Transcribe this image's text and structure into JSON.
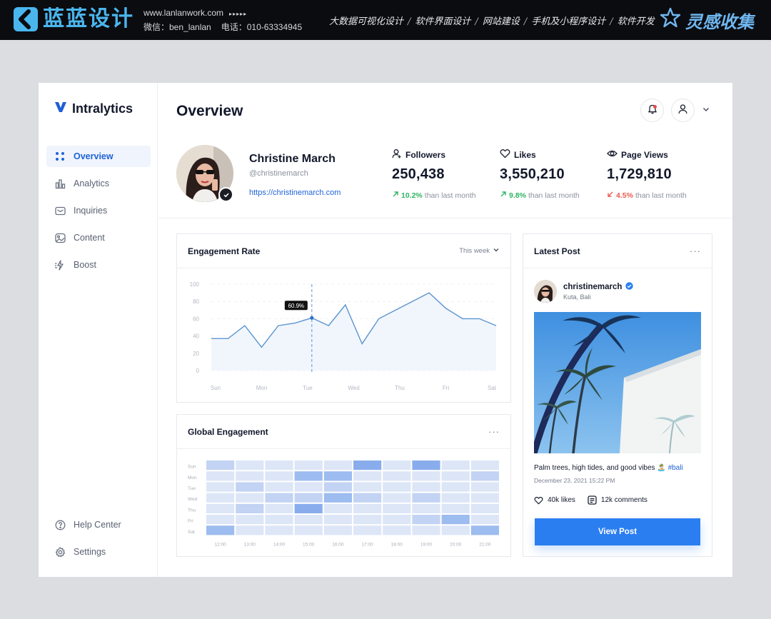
{
  "banner": {
    "brand": "蓝蓝设计",
    "website": "www.lanlanwork.com",
    "arrows": "▸▸▸▸▸",
    "wechat": "微信：ben_lanlan",
    "phone": "电话：010-63334945",
    "services": [
      "大数据可视化设计",
      "软件界面设计",
      "网站建设",
      "手机及小程序设计",
      "软件开发"
    ],
    "separator": "/",
    "collect": "灵感收集"
  },
  "app": {
    "logo": "Intralytics",
    "nav": [
      {
        "label": "Overview",
        "icon": "grid-dots-icon",
        "active": true
      },
      {
        "label": "Analytics",
        "icon": "bar-chart-icon"
      },
      {
        "label": "Inquiries",
        "icon": "mail-icon"
      },
      {
        "label": "Content",
        "icon": "image-icon"
      },
      {
        "label": "Boost",
        "icon": "boost-icon"
      }
    ],
    "nav_bottom": [
      {
        "label": "Help Center",
        "icon": "help-icon"
      },
      {
        "label": "Settings",
        "icon": "gear-icon"
      }
    ],
    "page_title": "Overview",
    "profile": {
      "name": "Christine March",
      "handle": "@christinemarch",
      "link": "https://christinemarch.com"
    },
    "stats": [
      {
        "label": "Followers",
        "icon": "user-icon",
        "value": "250,438",
        "change": "10.2%",
        "direction": "up",
        "suffix": "than last month"
      },
      {
        "label": "Likes",
        "icon": "heart-icon",
        "value": "3,550,210",
        "change": "9.8%",
        "direction": "up",
        "suffix": "than last month"
      },
      {
        "label": "Page Views",
        "icon": "eye-icon",
        "value": "1,729,810",
        "change": "4.5%",
        "direction": "down",
        "suffix": "than last month"
      }
    ],
    "engagement": {
      "title": "Engagement Rate",
      "period": "This week",
      "tooltip": "60.9%"
    },
    "global": {
      "title": "Global Engagement",
      "more": "···"
    },
    "latest_post": {
      "title": "Latest Post",
      "more": "···",
      "username": "christinemarch",
      "location": "Kuta, Bali",
      "caption": "Palm trees, high tides, and good vibes 🏝️ ",
      "hashtag": "#bali",
      "date": "December 23, 2021 15:22 PM",
      "likes": "40k likes",
      "comments": "12k comments",
      "button": "View Post"
    }
  },
  "chart_data": [
    {
      "type": "line",
      "x": [
        "Sun",
        "",
        "",
        "Mon",
        "",
        "",
        "Tue",
        "",
        "",
        "Wed",
        "",
        "",
        "Thu",
        "",
        "",
        "Fri",
        "",
        "",
        "Sat"
      ],
      "y_ticks": [
        0,
        20,
        40,
        60,
        80,
        100
      ],
      "x_ticks": [
        "Sun",
        "Mon",
        "Tue",
        "Wed",
        "Thu",
        "Fri",
        "Sat"
      ],
      "values": [
        37,
        37,
        52,
        27,
        52,
        55,
        60.9,
        52,
        76,
        31,
        60,
        70,
        80,
        90,
        72,
        60,
        60,
        52
      ],
      "ylim": [
        0,
        100
      ],
      "highlight_index": 6,
      "grid": true
    },
    {
      "type": "heatmap",
      "rows": [
        "Sun",
        "Mon",
        "Tue",
        "Wed",
        "Thu",
        "Fri",
        "Sat"
      ],
      "columns": [
        "12:00",
        "13:00",
        "14:00",
        "15:00",
        "16:00",
        "17:00",
        "18:00",
        "19:00",
        "20:00",
        "21:00"
      ],
      "values": [
        [
          2,
          1,
          1,
          1,
          1,
          4,
          1,
          4,
          1,
          1
        ],
        [
          1,
          1,
          1,
          3,
          3,
          1,
          1,
          1,
          1,
          2
        ],
        [
          1,
          2,
          1,
          1,
          2,
          1,
          1,
          1,
          1,
          1
        ],
        [
          1,
          1,
          2,
          2,
          3,
          2,
          1,
          2,
          1,
          1
        ],
        [
          1,
          2,
          1,
          4,
          1,
          1,
          1,
          1,
          1,
          1
        ],
        [
          1,
          1,
          1,
          1,
          1,
          1,
          1,
          2,
          3,
          1
        ],
        [
          3,
          1,
          1,
          1,
          1,
          1,
          1,
          1,
          1,
          3
        ]
      ],
      "scale_colors": [
        "#eef2fa",
        "#dde6f7",
        "#c2d3f3",
        "#9dbcef",
        "#89adec"
      ]
    }
  ]
}
